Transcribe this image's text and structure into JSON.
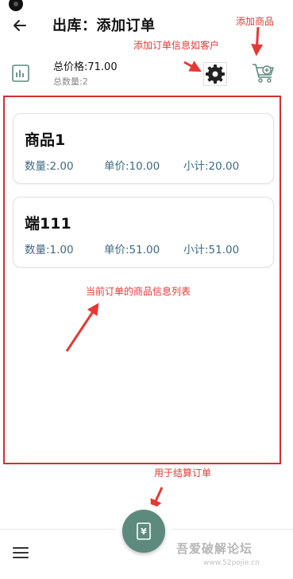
{
  "header": {
    "title": "出库：添加订单"
  },
  "summary": {
    "total_price": "总价格:71.00",
    "total_quantity": "总数量:2"
  },
  "items": [
    {
      "name": "商品1",
      "quantity": "数量:2.00",
      "unit_price": "单价:10.00",
      "subtotal": "小计:20.00"
    },
    {
      "name": "端111",
      "quantity": "数量:1.00",
      "unit_price": "单价:51.00",
      "subtotal": "小计:51.00"
    }
  ],
  "annotations": {
    "add_product": "添加商品",
    "add_order_info": "添加订单信息如客户",
    "list_info": "当前订单的商品信息列表",
    "checkout": "用于结算订单"
  },
  "fab": {
    "symbol": "¥"
  },
  "watermark": {
    "text": "吾爱破解论坛",
    "url": "www.52pojie.cn"
  },
  "colors": {
    "accent": "#5e8a7d",
    "value_text": "#3e6b86",
    "annotation": "#e53935"
  },
  "icons": [
    "back-arrow-icon",
    "bar-chart-icon",
    "gear-icon",
    "cart-add-icon",
    "menu-icon",
    "receipt-yuan-icon"
  ]
}
